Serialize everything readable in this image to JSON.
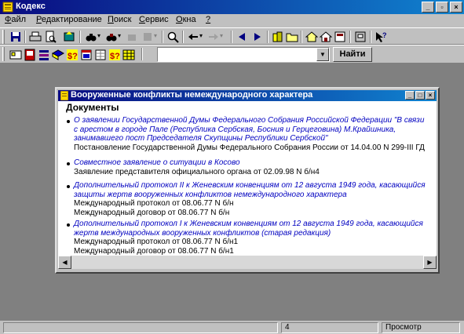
{
  "app": {
    "title": "Кодекс",
    "window_buttons": [
      "_",
      "▫",
      "×"
    ]
  },
  "menu": [
    {
      "acc": "Ф",
      "rest": "айл"
    },
    {
      "acc": "Р",
      "rest": "едактирование"
    },
    {
      "acc": "П",
      "rest": "оиск"
    },
    {
      "acc": "С",
      "rest": "ервис"
    },
    {
      "acc": "О",
      "rest": "кна"
    },
    {
      "acc": "?",
      "rest": ""
    }
  ],
  "search": {
    "value": "",
    "button_label": "Найти"
  },
  "document_window": {
    "title": "Вооруженные конфликты немеждународного характера",
    "heading": "Документы",
    "entries": [
      {
        "link": "О заявлении Государственной Думы Федерального Собрания Российской Федерации \"В связи с арестом в городе Пале (Республика Сербская, Босния и Герцеговина) М.Крайшника, занимавшего пост Председателя Скупщины Республики Сербской\"",
        "lines": [
          "Постановление Государственной Думы Федерального Собрания России от 14.04.00 N 299-III ГД"
        ]
      },
      {
        "link": "Совместное заявление о ситуации в Косово",
        "lines": [
          "Заявление представителя официального органа от 02.09.98 N б/н4"
        ]
      },
      {
        "link": "Дополнительный протокол II к Женевским конвенциям от 12 августа 1949 года, касающийся защиты жертв вооруженных конфликтов немеждународного характера",
        "lines": [
          "Международный протокол от 08.06.77 N б/н",
          "Международный договор от 08.06.77 N б/н"
        ]
      },
      {
        "link": "Дополнительный протокол I к Женевским конвенциям от 12 августа 1949 года, касающийся жертв международных вооруженных конфликтов (старая редакция)",
        "lines": [
          "Международный протокол от 08.06.77 N б/н1",
          "Международный договор от 08.06.77 N б/н1"
        ]
      }
    ]
  },
  "status": {
    "page": "4",
    "mode": "Просмотр"
  },
  "colors": {
    "titlebar": "#0a0a80",
    "link": "#0000c0",
    "workspace": "#808080"
  }
}
